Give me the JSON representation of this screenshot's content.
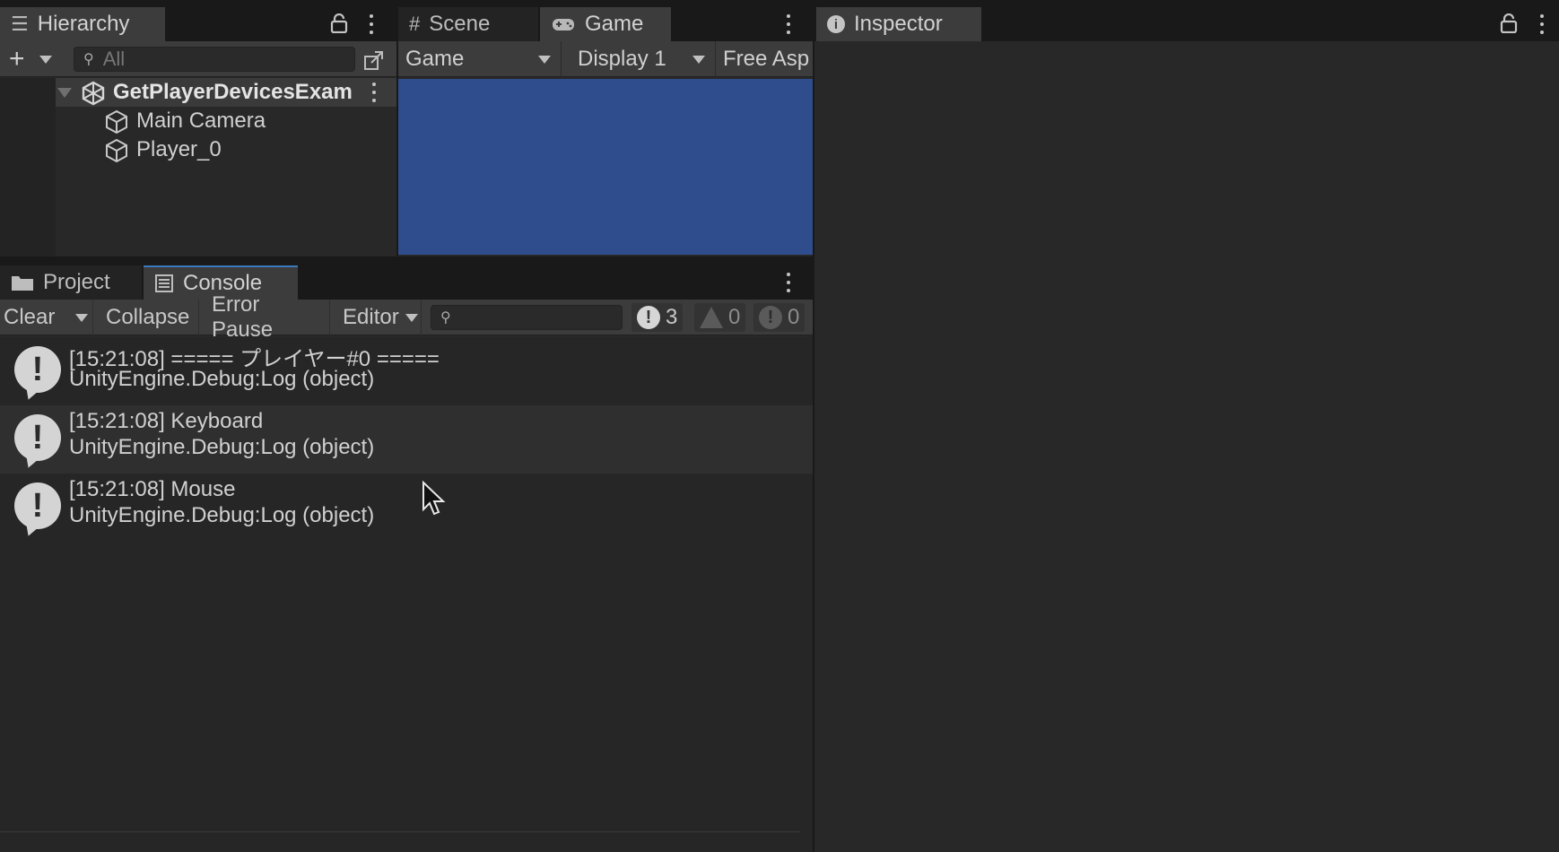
{
  "hierarchy": {
    "tab_label": "Hierarchy",
    "search_placeholder": "All",
    "scene_name": "GetPlayerDevicesExam",
    "items": [
      {
        "label": "Main Camera"
      },
      {
        "label": "Player_0"
      }
    ]
  },
  "viewport": {
    "tabs": [
      {
        "label": "Scene"
      },
      {
        "label": "Game"
      }
    ],
    "toolbar": {
      "mode": "Game",
      "display": "Display 1",
      "aspect": "Free Asp"
    }
  },
  "bottom_tabs": [
    {
      "label": "Project"
    },
    {
      "label": "Console"
    }
  ],
  "console": {
    "toolbar": {
      "clear": "Clear",
      "collapse": "Collapse",
      "error_pause": "Error Pause",
      "editor": "Editor"
    },
    "counts": {
      "log": "3",
      "warning": "0",
      "error": "0"
    },
    "entries": [
      {
        "message": "[15:21:08] ===== プレイヤー#0 =====",
        "source": "UnityEngine.Debug:Log (object)"
      },
      {
        "message": "[15:21:08] Keyboard",
        "source": "UnityEngine.Debug:Log (object)"
      },
      {
        "message": "[15:21:08] Mouse",
        "source": "UnityEngine.Debug:Log (object)"
      }
    ]
  },
  "inspector": {
    "tab_label": "Inspector"
  },
  "colors": {
    "game_view": "#2f4c8c",
    "active_tab_accent": "#3a79bb"
  }
}
